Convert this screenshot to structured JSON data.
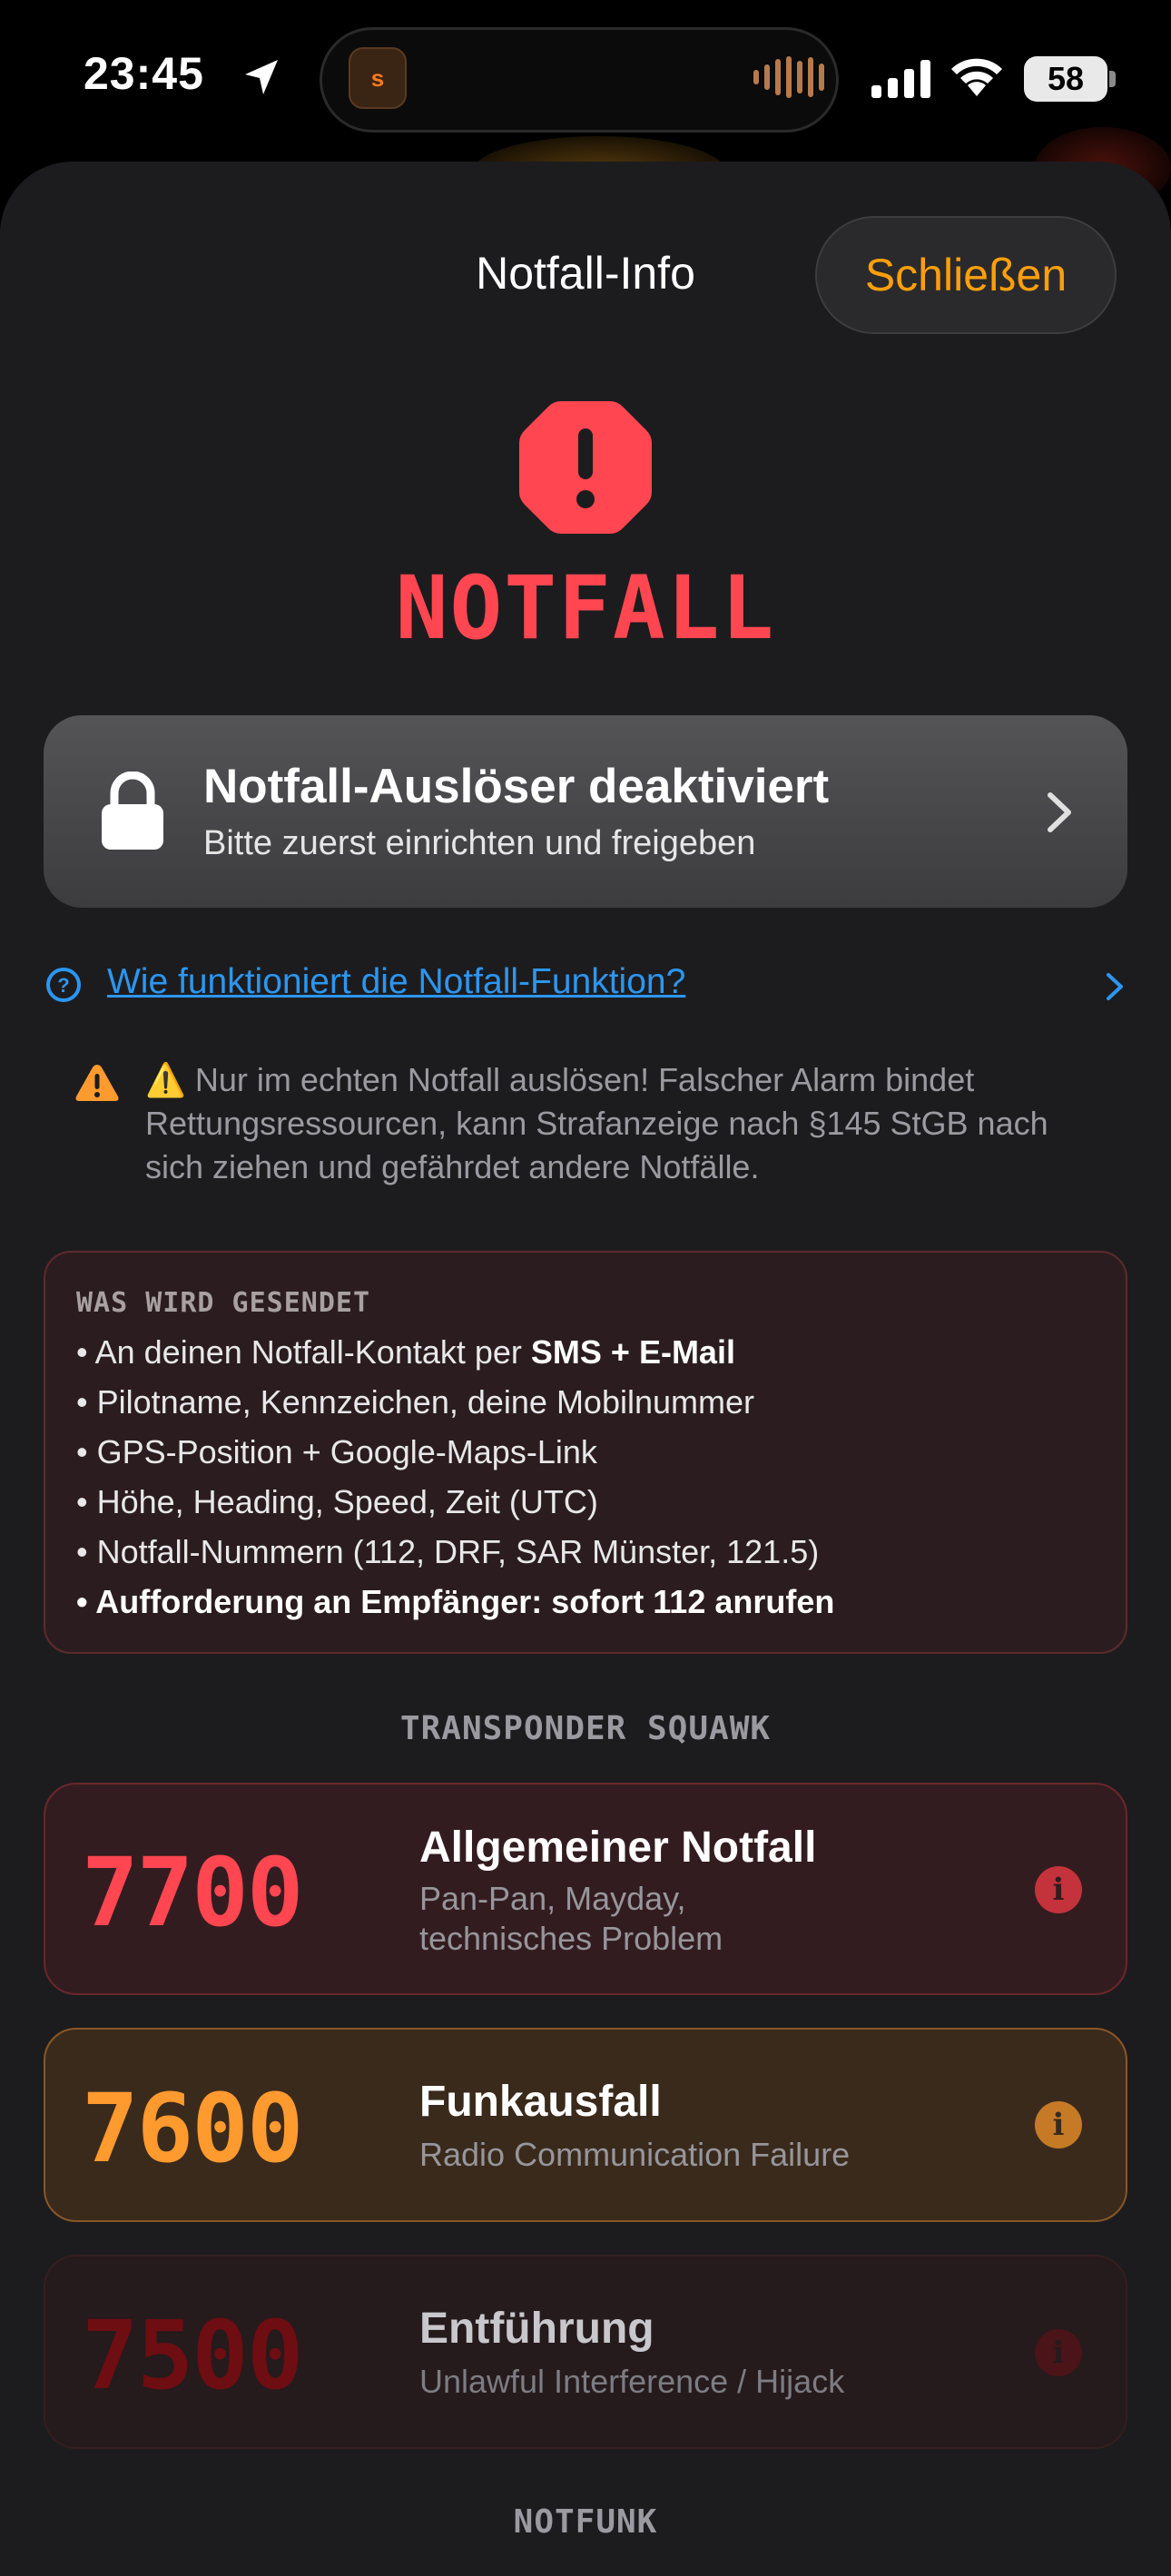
{
  "status_bar": {
    "time": "23:45",
    "battery": "58",
    "island_app": "s"
  },
  "sheet": {
    "title": "Notfall-Info",
    "close_label": "Schließen"
  },
  "hero": {
    "label": "NOTFALL"
  },
  "trigger": {
    "title": "Notfall-Auslöser deaktiviert",
    "subtitle": "Bitte zuerst einrichten und freigeben"
  },
  "help_link": "Wie funktioniert die Notfall-Funktion?",
  "warning": "⚠️ Nur im echten Notfall auslösen! Falscher Alarm bindet Rettungsressourcen, kann Strafanzeige nach §145 StGB nach sich ziehen und gefährdet andere Notfälle.",
  "send_info": {
    "heading": "WAS WIRD GESENDET",
    "items": [
      {
        "prefix": "• An deinen Notfall-Kontakt per ",
        "bold": "SMS + E-Mail"
      },
      {
        "text": "• Pilotname, Kennzeichen, deine Mobilnummer"
      },
      {
        "text": "• GPS-Position + Google-Maps-Link"
      },
      {
        "text": "• Höhe, Heading, Speed, Zeit (UTC)"
      },
      {
        "text": "• Notfall-Nummern (112, DRF, SAR Münster, 121.5)"
      },
      {
        "bold": "• Aufforderung an Empfänger: sofort 112 anrufen"
      }
    ]
  },
  "squawk": {
    "heading": "TRANSPONDER SQUAWK",
    "codes": [
      {
        "code": "7700",
        "title": "Allgemeiner Notfall",
        "subtitle_1": "Pan-Pan, Mayday,",
        "subtitle_2": "technisches Problem",
        "color": "#ff4651"
      },
      {
        "code": "7600",
        "title": "Funkausfall",
        "subtitle_1": "Radio Communication Failure",
        "color": "#ff9a2e"
      },
      {
        "code": "7500",
        "title": "Entführung",
        "subtitle_1": "Unlawful Interference / Hijack",
        "color": "#6e0d12"
      }
    ]
  },
  "next_section": "NOTFUNK",
  "icons": [
    "location-arrow-icon",
    "signal-icon",
    "wifi-icon",
    "battery-icon",
    "octagon-exclamation-icon",
    "lock-icon",
    "chevron-right-icon",
    "question-circle-icon",
    "warning-triangle-icon",
    "info-circle-icon"
  ]
}
